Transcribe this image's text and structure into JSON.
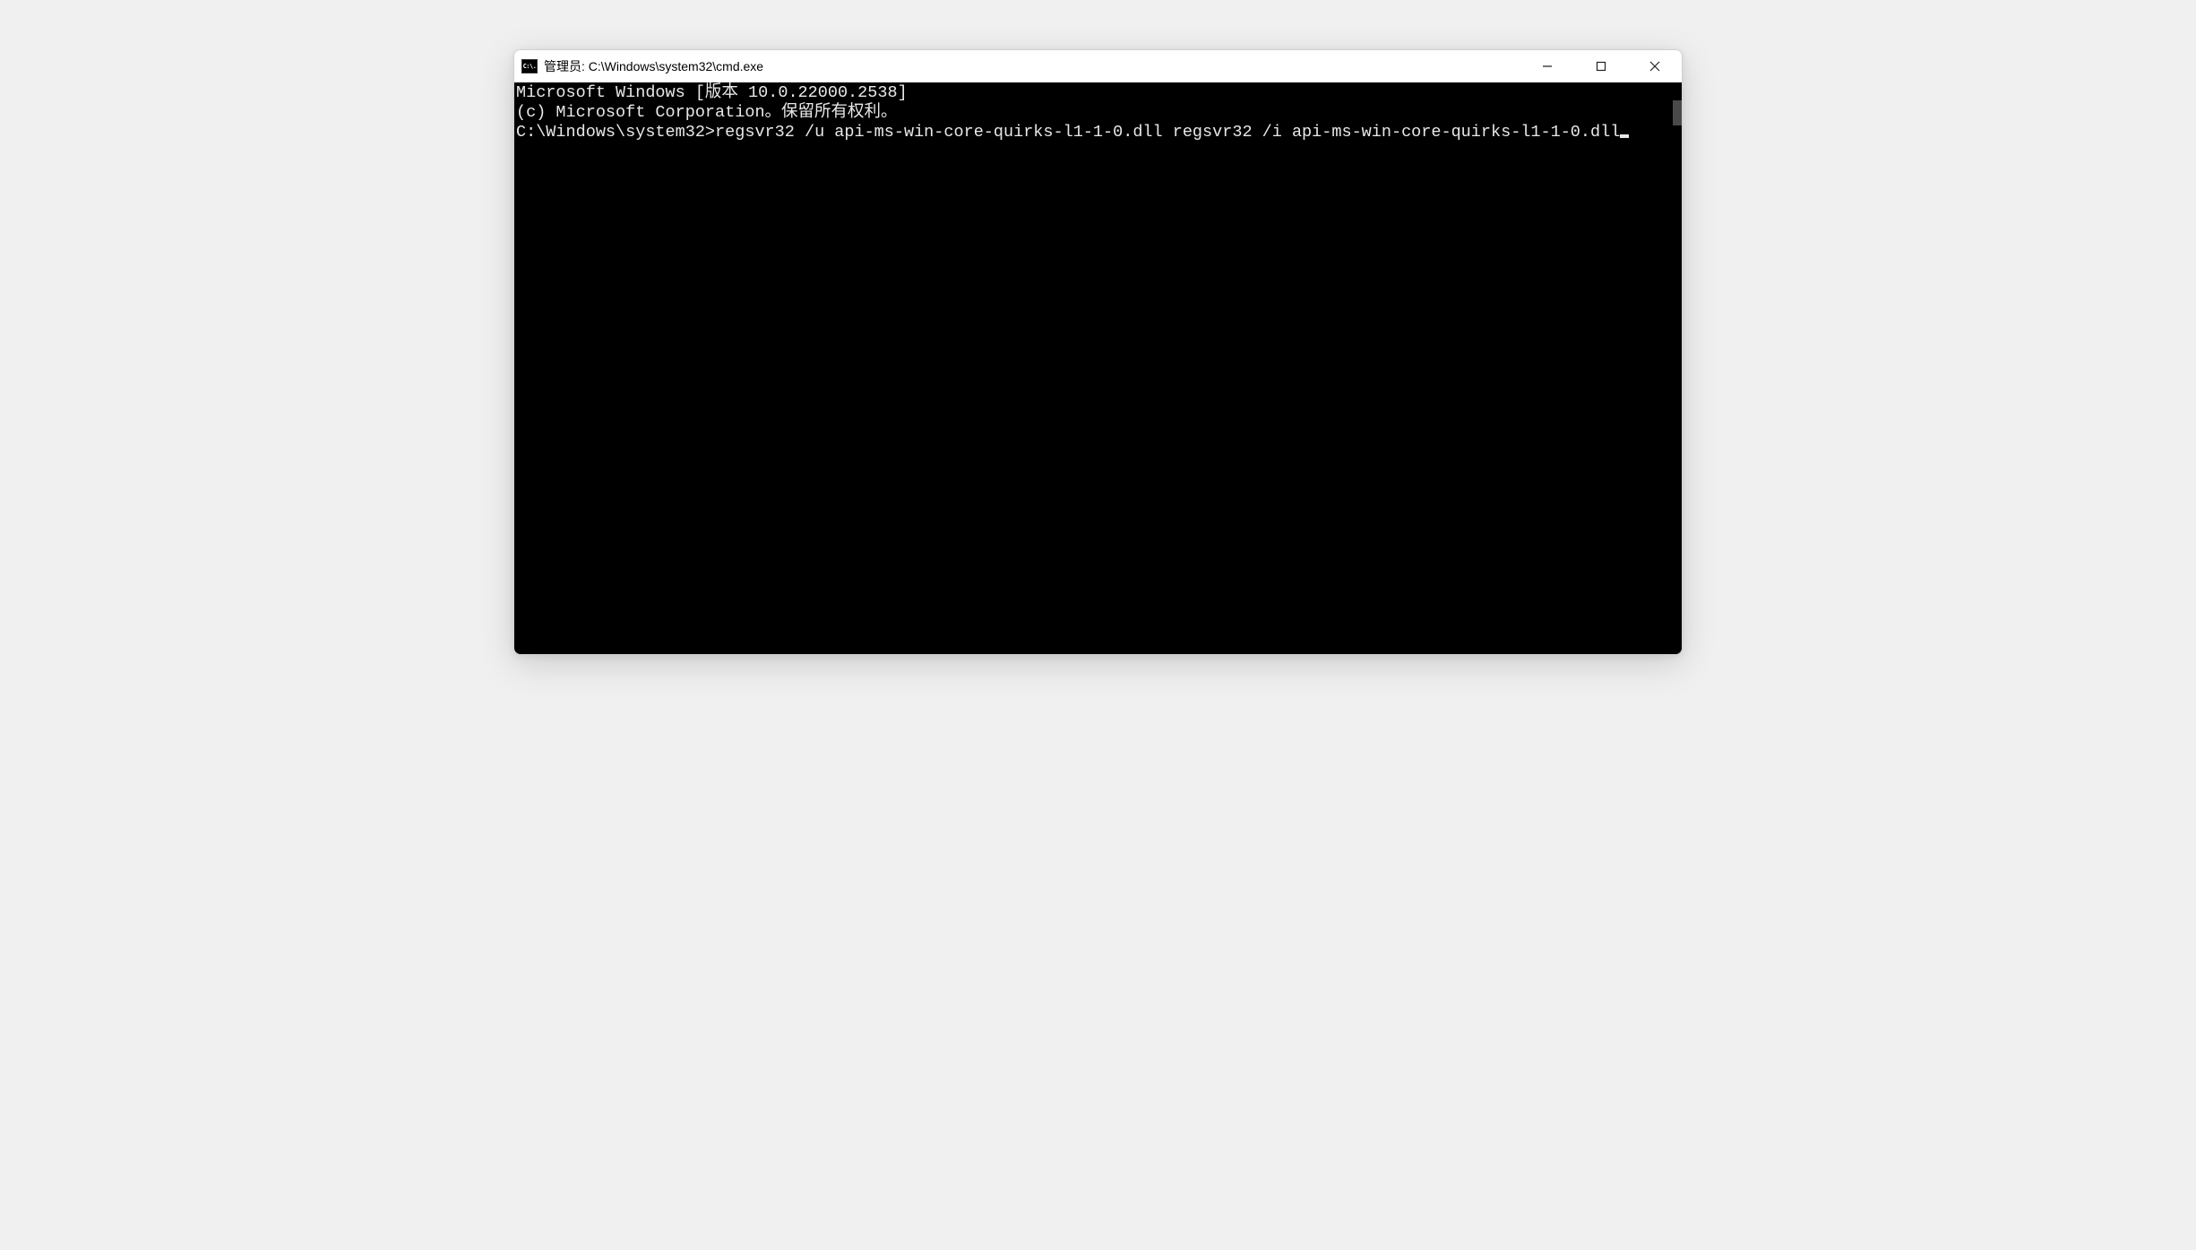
{
  "window": {
    "icon_text": "C:\\.",
    "title": "管理员: C:\\Windows\\system32\\cmd.exe"
  },
  "terminal": {
    "line1": "Microsoft Windows [版本 10.0.22000.2538]",
    "line2": "(c) Microsoft Corporation。保留所有权利。",
    "blank": "",
    "prompt": "C:\\Windows\\system32>",
    "command": "regsvr32 /u api-ms-win-core-quirks-l1-1-0.dll regsvr32 /i api-ms-win-core-quirks-l1-1-0.dll"
  }
}
